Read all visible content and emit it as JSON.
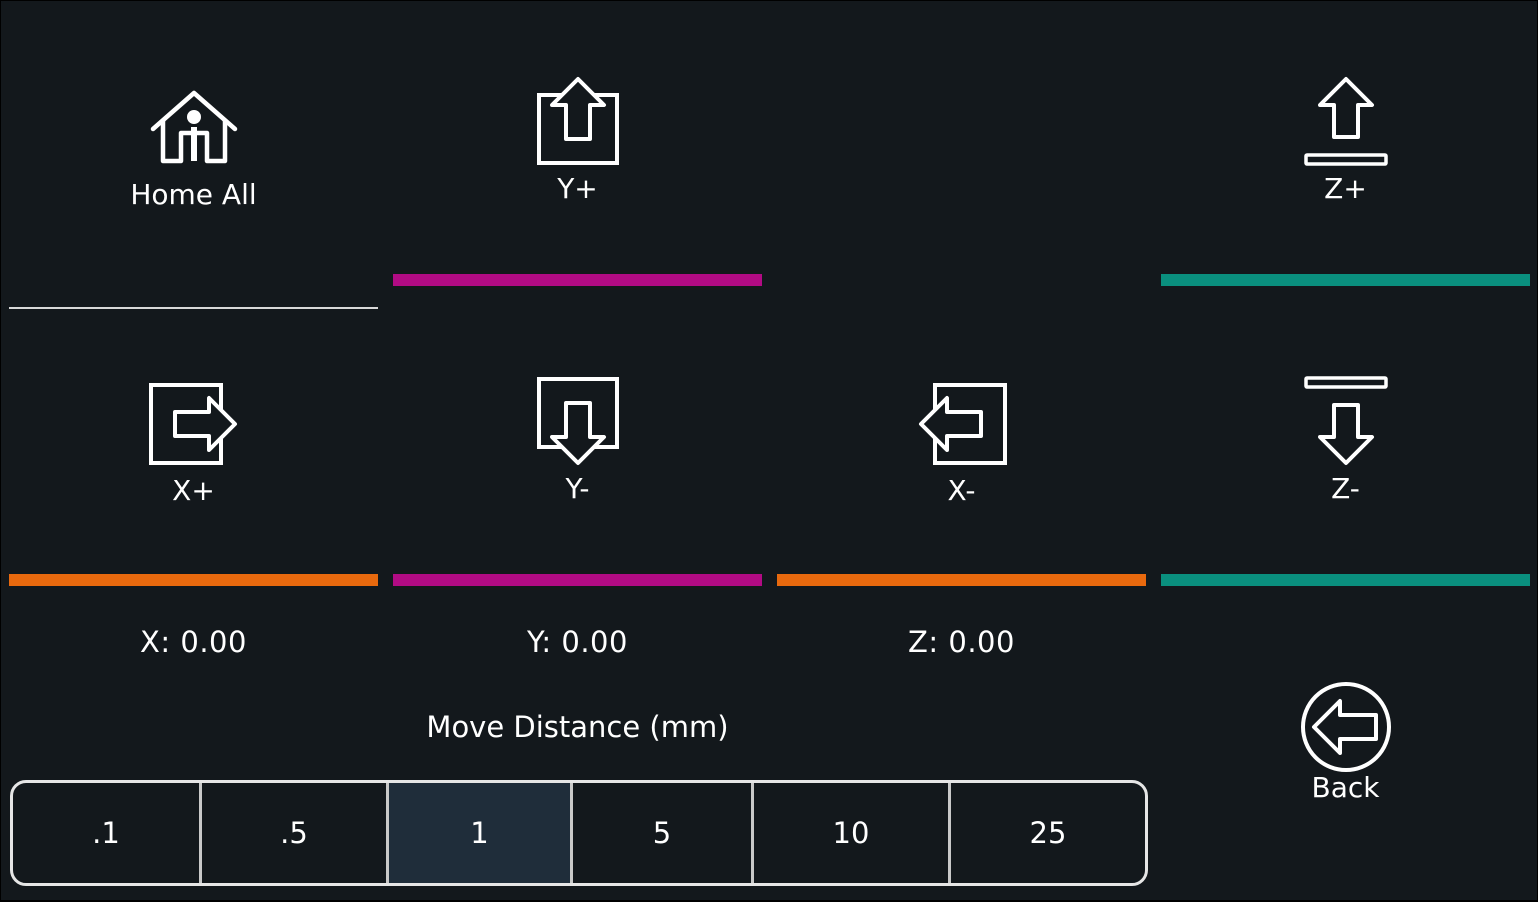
{
  "controls": {
    "home_all": {
      "label": "Home All",
      "icon": "home-icon"
    },
    "y_plus": {
      "label": "Y+",
      "icon": "arrow-up-box-icon"
    },
    "z_plus": {
      "label": "Z+",
      "icon": "arrow-up-bar-icon"
    },
    "x_plus": {
      "label": "X+",
      "icon": "arrow-right-box-icon"
    },
    "y_minus": {
      "label": "Y-",
      "icon": "arrow-down-box-icon"
    },
    "x_minus": {
      "label": "X-",
      "icon": "arrow-left-box-icon"
    },
    "z_minus": {
      "label": "Z-",
      "icon": "arrow-down-bar-icon"
    },
    "back": {
      "label": "Back",
      "icon": "circle-arrow-left-icon"
    }
  },
  "position": {
    "x": "X: 0.00",
    "y": "Y: 0.00",
    "z": "Z: 0.00"
  },
  "move_distance": {
    "title": "Move Distance (mm)",
    "options": [
      ".1",
      ".5",
      "1",
      "5",
      "10",
      "25"
    ],
    "selected": "1"
  },
  "colors": {
    "background": "#13181c",
    "x_axis": "#e8690e",
    "y_axis": "#b20b84",
    "z_axis": "#0a8f7e",
    "selected_option": "#1f2d3a"
  }
}
